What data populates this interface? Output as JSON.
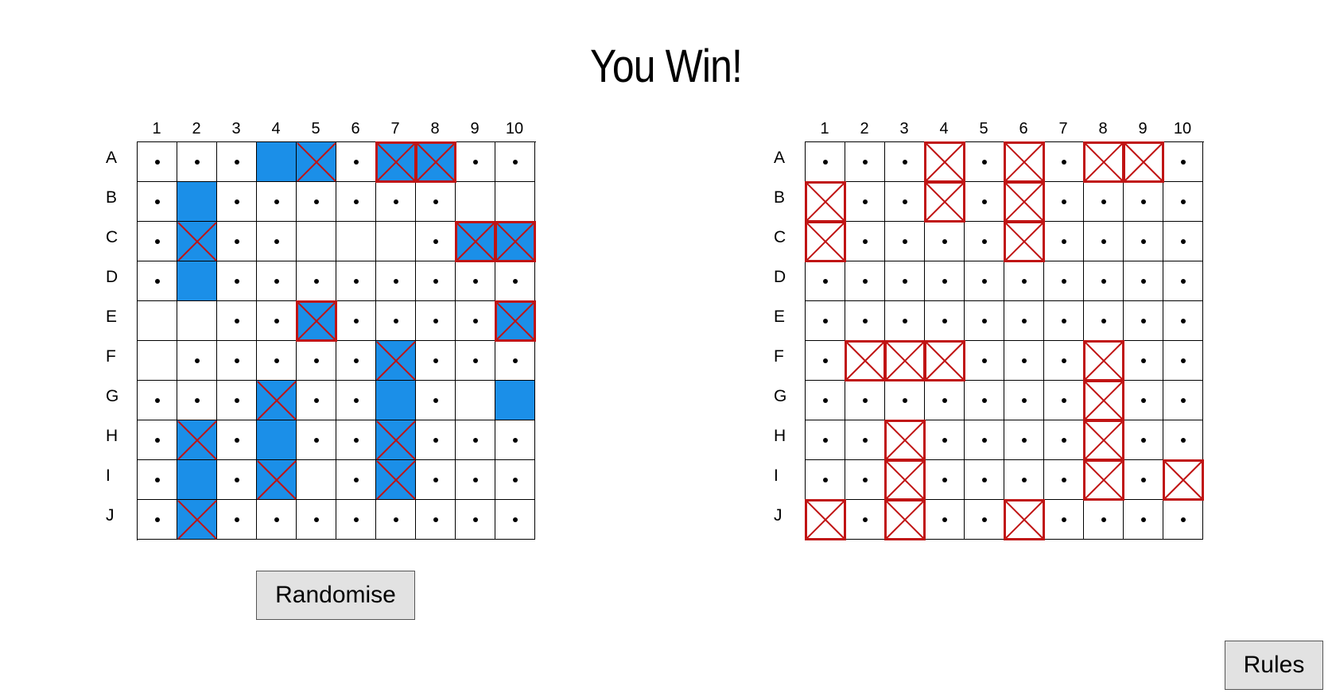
{
  "title": "You Win!",
  "columns": [
    "1",
    "2",
    "3",
    "4",
    "5",
    "6",
    "7",
    "8",
    "9",
    "10"
  ],
  "rows": [
    "A",
    "B",
    "C",
    "D",
    "E",
    "F",
    "G",
    "H",
    "I",
    "J"
  ],
  "cell_legend": {
    ".": "miss",
    "_": "empty",
    "S": "ship",
    "X": "hit on ship",
    "K": "sunk ship part",
    "Q": "sunk (enemy revealed)"
  },
  "colors": {
    "ship": "#1b8fe8",
    "hit": "#c01414",
    "grid": "#000000"
  },
  "player_board": {
    "grid": [
      "...SX.KK..",
      ".S......",
      ".X..___.KK",
      ".S........",
      "__..K....K",
      "_.....X...",
      "...X..S._S",
      ".X.S..X...",
      ".S.X_.X...",
      ".X........"
    ]
  },
  "enemy_board": {
    "grid": [
      "...Q.Q.QQ.",
      "Q..Q.Q....",
      "Q....Q....",
      "..........",
      "..........",
      ".QQQ...Q..",
      ".......Q..",
      "..Q....Q..",
      "..Q....Q.Q",
      "Q.Q..Q...."
    ]
  },
  "buttons": {
    "randomise": "Randomise",
    "rules": "Rules"
  }
}
